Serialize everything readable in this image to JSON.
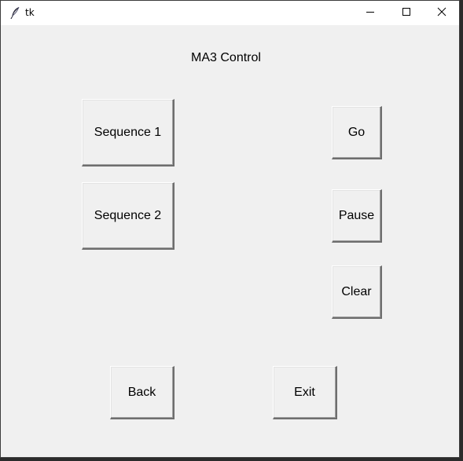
{
  "window": {
    "title": "tk",
    "controls": [
      "minimize-icon",
      "maximize-icon",
      "close-icon"
    ]
  },
  "main": {
    "heading": "MA3 Control",
    "buttons": {
      "sequence1": "Sequence 1",
      "sequence2": "Sequence 2",
      "go": "Go",
      "pause": "Pause",
      "clear": "Clear",
      "back": "Back",
      "exit": "Exit"
    }
  },
  "colors": {
    "background": "#f0f0f0",
    "titlebar": "#ffffff",
    "text": "#000000"
  }
}
